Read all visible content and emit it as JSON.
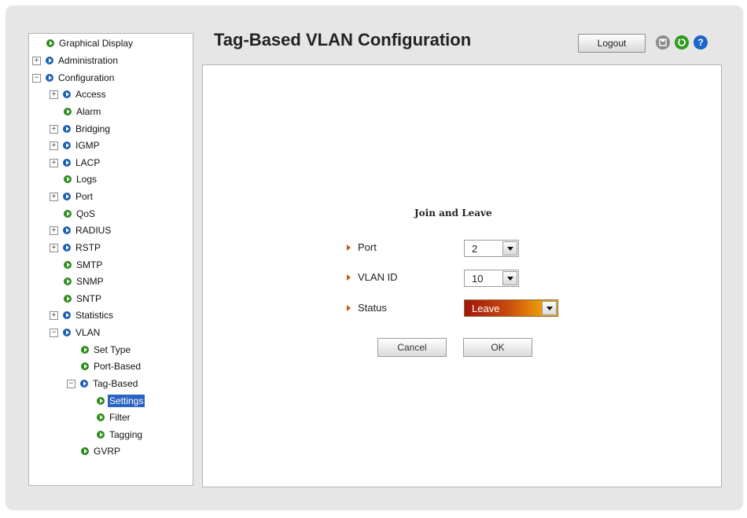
{
  "page": {
    "title": "Tag-Based VLAN Configuration"
  },
  "header": {
    "logout_label": "Logout",
    "icons": [
      "save-icon",
      "refresh-icon",
      "help-icon"
    ]
  },
  "tree": [
    {
      "label": "Graphical Display",
      "expander": "",
      "icon": "green"
    },
    {
      "label": "Administration",
      "expander": "+",
      "icon": "blue"
    },
    {
      "label": "Configuration",
      "expander": "−",
      "icon": "blue"
    },
    {
      "label": "Access",
      "expander": "+",
      "icon": "blue"
    },
    {
      "label": "Alarm",
      "expander": "",
      "icon": "green"
    },
    {
      "label": "Bridging",
      "expander": "+",
      "icon": "blue"
    },
    {
      "label": "IGMP",
      "expander": "+",
      "icon": "blue"
    },
    {
      "label": "LACP",
      "expander": "+",
      "icon": "blue"
    },
    {
      "label": "Logs",
      "expander": "",
      "icon": "green"
    },
    {
      "label": "Port",
      "expander": "+",
      "icon": "blue"
    },
    {
      "label": "QoS",
      "expander": "",
      "icon": "green"
    },
    {
      "label": "RADIUS",
      "expander": "+",
      "icon": "blue"
    },
    {
      "label": "RSTP",
      "expander": "+",
      "icon": "blue"
    },
    {
      "label": "SMTP",
      "expander": "",
      "icon": "green"
    },
    {
      "label": "SNMP",
      "expander": "",
      "icon": "green"
    },
    {
      "label": "SNTP",
      "expander": "",
      "icon": "green"
    },
    {
      "label": "Statistics",
      "expander": "+",
      "icon": "blue"
    },
    {
      "label": "VLAN",
      "expander": "−",
      "icon": "blue"
    },
    {
      "label": "Set Type",
      "expander": "",
      "icon": "green"
    },
    {
      "label": "Port-Based",
      "expander": "",
      "icon": "green"
    },
    {
      "label": "Tag-Based",
      "expander": "−",
      "icon": "blue"
    },
    {
      "label": "Settings",
      "expander": "",
      "icon": "green",
      "selected": true
    },
    {
      "label": "Filter",
      "expander": "",
      "icon": "green"
    },
    {
      "label": "Tagging",
      "expander": "",
      "icon": "green"
    },
    {
      "label": "GVRP",
      "expander": "",
      "icon": "green"
    }
  ],
  "form": {
    "section_title": "Join and Leave",
    "port": {
      "label": "Port",
      "value": "2"
    },
    "vlan_id": {
      "label": "VLAN ID",
      "value": "10"
    },
    "status": {
      "label": "Status",
      "value": "Leave"
    },
    "cancel_label": "Cancel",
    "ok_label": "OK"
  }
}
